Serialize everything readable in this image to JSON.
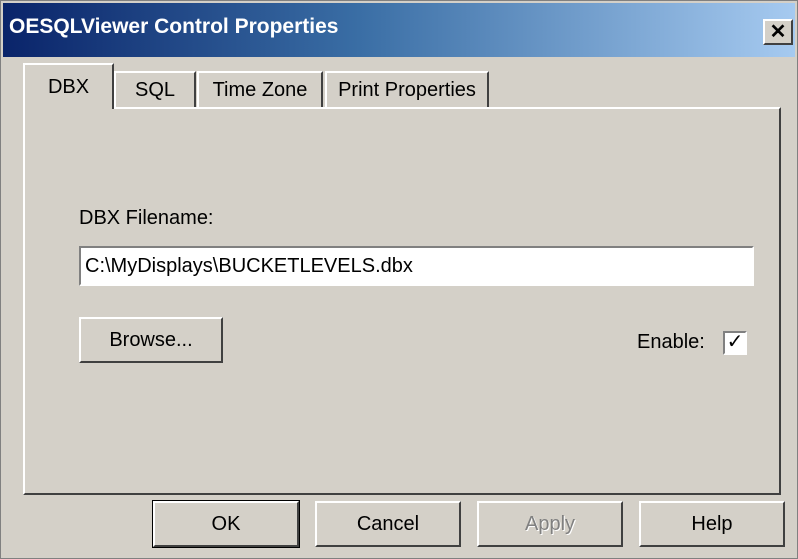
{
  "window": {
    "title": "OESQLViewer Control Properties",
    "close_glyph": "✕"
  },
  "tabs": [
    {
      "label": "DBX",
      "active": true
    },
    {
      "label": "SQL",
      "active": false
    },
    {
      "label": "Time Zone",
      "active": false
    },
    {
      "label": "Print Properties",
      "active": false
    }
  ],
  "dbx": {
    "filename_label": "DBX Filename:",
    "filename_value": "C:\\MyDisplays\\BUCKETLEVELS.dbx",
    "browse_label": "Browse...",
    "enable_label": "Enable:",
    "enable_checked": true,
    "check_glyph": "✓"
  },
  "footer": {
    "ok_label": "OK",
    "cancel_label": "Cancel",
    "apply_label": "Apply",
    "apply_disabled": true,
    "help_label": "Help"
  },
  "colors": {
    "dialog_face": "#d4d0c8",
    "title_start": "#0a246a",
    "title_end": "#a6caf0"
  }
}
